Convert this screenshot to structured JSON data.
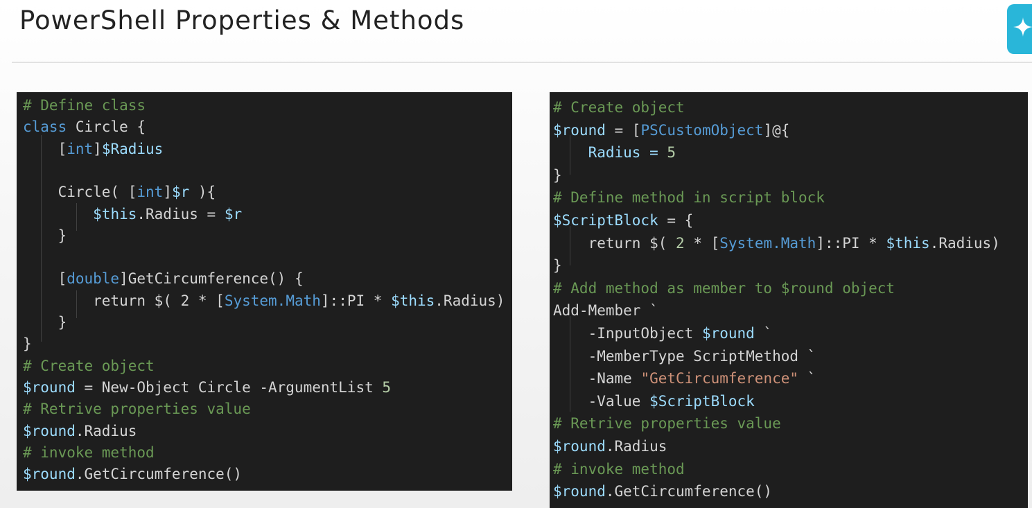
{
  "slide": {
    "title": "PowerShell Properties & Methods"
  },
  "toolbar": {
    "assistant_icon": "sparkle-icon",
    "accent": "#29b6d9"
  },
  "code_left": {
    "background": "#1e1e1e",
    "lines": [
      [
        {
          "t": "# Define class",
          "c": "c"
        }
      ],
      [
        {
          "t": "class ",
          "c": "k"
        },
        {
          "t": "Circle {",
          "c": "p"
        }
      ],
      [
        {
          "t": "    [",
          "c": "p"
        },
        {
          "t": "int",
          "c": "k"
        },
        {
          "t": "]",
          "c": "p"
        },
        {
          "t": "$Radius",
          "c": "v"
        }
      ],
      [],
      [
        {
          "t": "    Circle( [",
          "c": "p"
        },
        {
          "t": "int",
          "c": "k"
        },
        {
          "t": "]",
          "c": "p"
        },
        {
          "t": "$r",
          "c": "v"
        },
        {
          "t": " ){",
          "c": "p"
        }
      ],
      [
        {
          "t": "        ",
          "c": "p"
        },
        {
          "t": "$this",
          "c": "v"
        },
        {
          "t": ".Radius = ",
          "c": "p"
        },
        {
          "t": "$r",
          "c": "v"
        }
      ],
      [
        {
          "t": "    }",
          "c": "p"
        }
      ],
      [],
      [
        {
          "t": "    [",
          "c": "p"
        },
        {
          "t": "double",
          "c": "k"
        },
        {
          "t": "]GetCircumference() {",
          "c": "p"
        }
      ],
      [
        {
          "t": "        return ",
          "c": "p"
        },
        {
          "t": "$(",
          "c": "p"
        },
        {
          "t": " 2",
          "c": "p"
        },
        {
          "t": " * [",
          "c": "p"
        },
        {
          "t": "System.Math",
          "c": "k"
        },
        {
          "t": "]::PI * ",
          "c": "p"
        },
        {
          "t": "$this",
          "c": "v"
        },
        {
          "t": ".Radius)",
          "c": "p"
        }
      ],
      [
        {
          "t": "    }",
          "c": "p"
        }
      ],
      [
        {
          "t": "}",
          "c": "p"
        }
      ],
      [
        {
          "t": "# Create object",
          "c": "c"
        }
      ],
      [
        {
          "t": "$round",
          "c": "v"
        },
        {
          "t": " = New-Object Circle -ArgumentList ",
          "c": "p"
        },
        {
          "t": "5",
          "c": "n"
        }
      ],
      [
        {
          "t": "# Retrive properties value",
          "c": "c"
        }
      ],
      [
        {
          "t": "$round",
          "c": "v"
        },
        {
          "t": ".Radius",
          "c": "p"
        }
      ],
      [
        {
          "t": "# invoke method",
          "c": "c"
        }
      ],
      [
        {
          "t": "$round",
          "c": "v"
        },
        {
          "t": ".GetCircumference()",
          "c": "p"
        }
      ]
    ]
  },
  "code_right": {
    "background": "#1e1e1e",
    "lines": [
      [
        {
          "t": "# Create object",
          "c": "c"
        }
      ],
      [
        {
          "t": "$round",
          "c": "v"
        },
        {
          "t": " = [",
          "c": "p"
        },
        {
          "t": "PSCustomObject",
          "c": "k"
        },
        {
          "t": "]@{",
          "c": "p"
        }
      ],
      [
        {
          "t": "    Radius = ",
          "c": "v"
        },
        {
          "t": "5",
          "c": "n"
        }
      ],
      [
        {
          "t": "}",
          "c": "p"
        }
      ],
      [
        {
          "t": "# Define method in script block",
          "c": "c"
        }
      ],
      [
        {
          "t": "$ScriptBlock",
          "c": "v"
        },
        {
          "t": " = {",
          "c": "p"
        }
      ],
      [
        {
          "t": "    return ",
          "c": "p"
        },
        {
          "t": "$(",
          "c": "p"
        },
        {
          "t": " 2",
          "c": "n"
        },
        {
          "t": " * [",
          "c": "p"
        },
        {
          "t": "System.Math",
          "c": "k"
        },
        {
          "t": "]::PI * ",
          "c": "p"
        },
        {
          "t": "$this",
          "c": "v"
        },
        {
          "t": ".Radius)",
          "c": "p"
        }
      ],
      [
        {
          "t": "}",
          "c": "p"
        }
      ],
      [
        {
          "t": "# Add method as member to $round object",
          "c": "c"
        }
      ],
      [
        {
          "t": "Add-Member `",
          "c": "p"
        }
      ],
      [
        {
          "t": "    -InputObject ",
          "c": "p"
        },
        {
          "t": "$round",
          "c": "v"
        },
        {
          "t": " `",
          "c": "p"
        }
      ],
      [
        {
          "t": "    -MemberType ScriptMethod `",
          "c": "p"
        }
      ],
      [
        {
          "t": "    -Name ",
          "c": "p"
        },
        {
          "t": "\"GetCircumference\"",
          "c": "s"
        },
        {
          "t": " `",
          "c": "p"
        }
      ],
      [
        {
          "t": "    -Value ",
          "c": "p"
        },
        {
          "t": "$ScriptBlock",
          "c": "v"
        }
      ],
      [
        {
          "t": "# Retrive properties value",
          "c": "c"
        }
      ],
      [
        {
          "t": "$round",
          "c": "v"
        },
        {
          "t": ".Radius",
          "c": "p"
        }
      ],
      [
        {
          "t": "# invoke method",
          "c": "c"
        }
      ],
      [
        {
          "t": "$round",
          "c": "v"
        },
        {
          "t": ".GetCircumference()",
          "c": "p"
        }
      ]
    ]
  }
}
